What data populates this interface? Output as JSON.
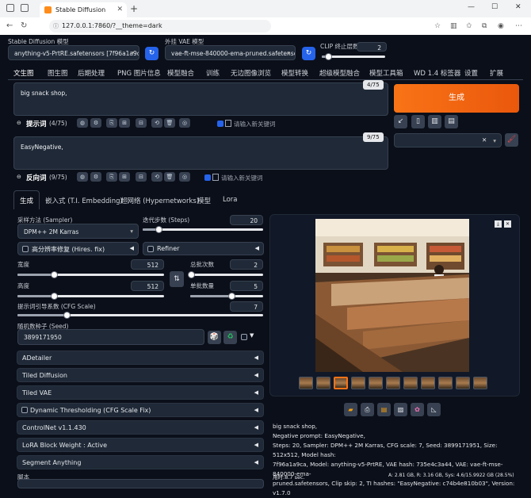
{
  "browser": {
    "tab_title": "Stable Diffusion",
    "url": "127.0.0.1:7860/?__theme=dark"
  },
  "top": {
    "model_label": "Stable Diffusion 模型",
    "model_value": "anything-v5-PrtRE.safetensors [7f96a1a9ca]",
    "vae_label": "外挂 VAE 模型",
    "vae_value": "vae-ft-mse-840000-ema-pruned.safetensors",
    "clip_label": "CLIP 终止层数",
    "clip_value": "2"
  },
  "main_tabs": [
    "文生图",
    "图生图",
    "后期处理",
    "PNG 图片信息",
    "模型融合",
    "训练",
    "无边图像浏览",
    "模型转换",
    "超级模型融合",
    "模型工具箱",
    "WD 1.4 标签器",
    "设置",
    "扩展"
  ],
  "prompt": {
    "text": "big snack shop,",
    "count": "4/75",
    "label": "提示词",
    "label_count": "(4/75)",
    "kw_placeholder": "请输入新关键词"
  },
  "neg": {
    "text": "EasyNegative,",
    "count": "9/75",
    "label": "反向词",
    "label_count": "(9/75)",
    "kw_placeholder": "请输入新关键词"
  },
  "generate_label": "生成",
  "sub_tabs": [
    "生成",
    "嵌入式 (T.I. Embedding)",
    "超网络 (Hypernetworks)",
    "模型",
    "Lora"
  ],
  "sampler": {
    "label": "采样方法 (Sampler)",
    "value": "DPM++ 2M Karras"
  },
  "steps": {
    "label": "迭代步数 (Steps)",
    "value": "20",
    "fraction": 0.13
  },
  "hires": {
    "label": "高分辨率修复 (Hires. fix)"
  },
  "refiner": {
    "label": "Refiner"
  },
  "width": {
    "label": "宽度",
    "value": "512",
    "fraction": 0.25
  },
  "height": {
    "label": "高度",
    "value": "512",
    "fraction": 0.25
  },
  "batch_count": {
    "label": "总批次数",
    "value": "2",
    "fraction": 0.01
  },
  "batch_size": {
    "label": "单批数量",
    "value": "5",
    "fraction": 0.57
  },
  "cfg": {
    "label": "提示词引导系数 (CFG Scale)",
    "value": "7",
    "fraction": 0.2
  },
  "seed": {
    "label": "随机数种子 (Seed)",
    "value": "3899171950"
  },
  "accordions": [
    "ADetailer",
    "Tiled Diffusion",
    "Tiled VAE",
    "Dynamic Thresholding (CFG Scale Fix)",
    "ControlNet v1.1.430",
    "LoRA Block Weight : Active",
    "Segment Anything"
  ],
  "script_label": "脚本",
  "info": {
    "line1": "big snack shop,",
    "line2": "Negative prompt: EasyNegative,",
    "line3": "Steps: 20, Sampler: DPM++ 2M Karras, CFG scale: 7, Seed: 3899171951, Size: 512x512, Model hash:",
    "line4": "7f96a1a9ca, Model: anything-v5-PrtRE, VAE hash: 735e4c3a44, VAE: vae-ft-mse-840000-ema-",
    "line5": "pruned.safetensors, Clip skip: 2, TI hashes: \"EasyNegative: c74b4e810b03\", Version: v1.7.0",
    "time": "用时:8.7 sec.",
    "mem": "A: 2.81 GB, R: 3.16 GB, Sys: 4.6/15.9922 GB (28.5%)"
  }
}
